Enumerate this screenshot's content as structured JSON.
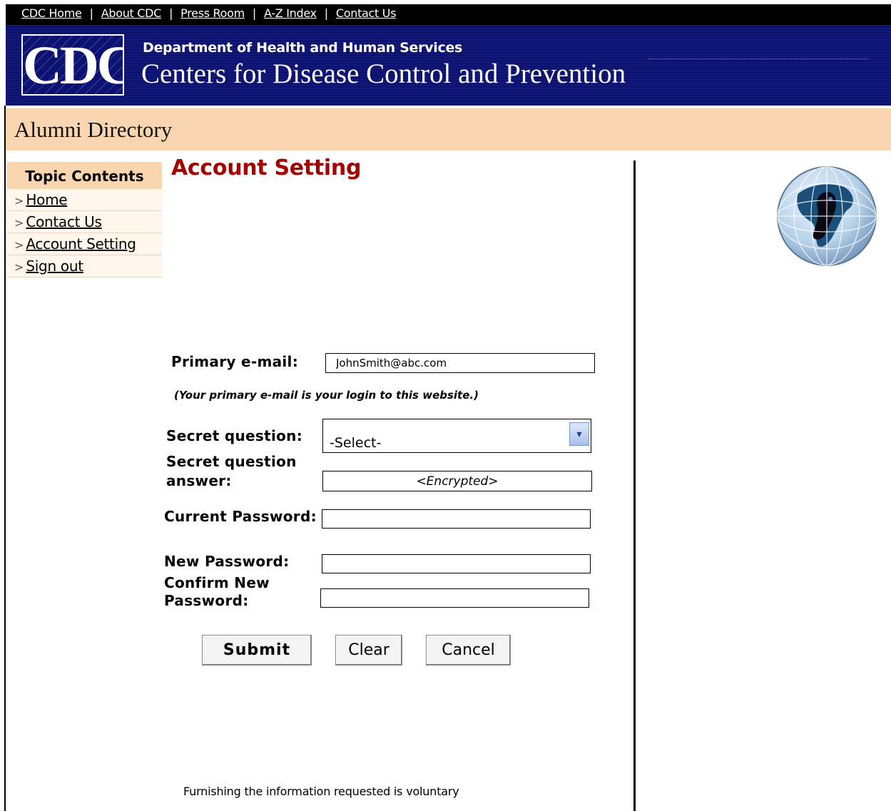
{
  "topnav": {
    "links": [
      "CDC Home",
      "About CDC",
      "Press Room",
      "A-Z Index",
      "Contact Us"
    ],
    "separator": "|"
  },
  "banner": {
    "logo_text": "CDC",
    "department": "Department of Health and Human Services",
    "agency": "Centers for Disease Control and Prevention"
  },
  "section_title": "Alumni Directory",
  "sidebar": {
    "heading": "Topic Contents",
    "marker": ">",
    "items": [
      "Home",
      "Contact Us",
      "Account Setting",
      "Sign out"
    ]
  },
  "page_title": "Account Setting",
  "form": {
    "primary_email_label": "Primary e-mail:",
    "primary_email_value": "JohnSmith@abc.com",
    "email_note": "(Your primary e-mail is your login to this website.)",
    "secret_question_label": "Secret question:",
    "secret_question_value": "-Select-",
    "secret_answer_label_1": "Secret question",
    "secret_answer_label_2": "answer:",
    "secret_answer_value": "<Encrypted>",
    "current_password_label": "Current Password:",
    "current_password_value": "",
    "new_password_label": "New Password:",
    "new_password_value": "",
    "confirm_password_label_1": "Confirm New",
    "confirm_password_label_2": "Password:",
    "confirm_password_value": ""
  },
  "buttons": {
    "submit": "Submit",
    "clear": "Clear",
    "cancel": "Cancel"
  },
  "footer_note": "Furnishing the information requested is voluntary",
  "colors": {
    "banner_blue": "#0b1270",
    "peach": "#fad6b0",
    "title_red": "#a40000"
  }
}
